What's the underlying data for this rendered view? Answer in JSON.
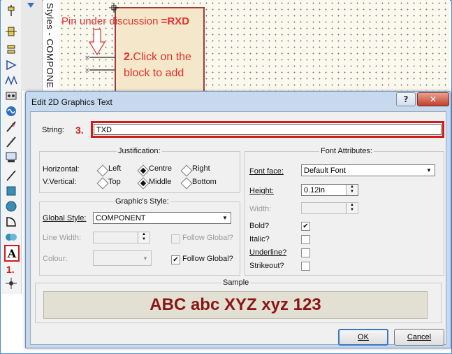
{
  "annotations": {
    "pin_note": "Pin under discussion",
    "pin_note_suffix": "=RXD",
    "step1": "1.",
    "step2_num": "2.",
    "step2_line1": "Click on the",
    "step2_line2": "block to add",
    "step3": "3."
  },
  "sheet": {
    "vertical_label": "Styles - COMPONE"
  },
  "toolbar": {
    "tools": [
      "component-pin-icon",
      "bus-icon",
      "terminal-icon",
      "port-icon",
      "probe-icon",
      "tape-icon",
      "generator-icon",
      "voltage-probe-icon",
      "current-probe-icon",
      "virtual-instrument-icon",
      "line-icon",
      "box-icon",
      "circle-icon",
      "arc-icon",
      "path-icon",
      "text-icon",
      "symbol-icon"
    ]
  },
  "dialog": {
    "title": "Edit 2D Graphics Text",
    "help": "?",
    "close": "✕",
    "string_label": "String:",
    "string_value": "TXD",
    "justification": {
      "title": "Justification:",
      "horizontal_label": "Horizontal:",
      "vertical_label": "V.Vertical:",
      "h_options": [
        "Left",
        "Centre",
        "Right"
      ],
      "h_selected": "Centre",
      "v_options": [
        "Top",
        "Middle",
        "Bottom"
      ],
      "v_selected": "Middle"
    },
    "graphics_style": {
      "title": "Graphic's Style:",
      "global_style_label": "Global Style:",
      "global_style_value": "COMPONENT",
      "line_width_label": "Line Width:",
      "colour_label": "Colour:",
      "follow_global_1": "Follow Global?",
      "follow_global_2": "Follow Global?",
      "follow_global_2_checked": true
    },
    "font": {
      "title": "Font Attributes:",
      "font_face_label": "Font face:",
      "font_face_value": "Default Font",
      "height_label": "Height:",
      "height_value": "0.12in",
      "width_label": "Width:",
      "bold_label": "Bold?",
      "italic_label": "Italic?",
      "underline_label": "Underline?",
      "strikeout_label": "Strikeout?",
      "bold_checked": true
    },
    "sample": {
      "title": "Sample",
      "text": "ABC abc XYZ xyz 123"
    },
    "ok": "OK",
    "cancel": "Cancel"
  }
}
